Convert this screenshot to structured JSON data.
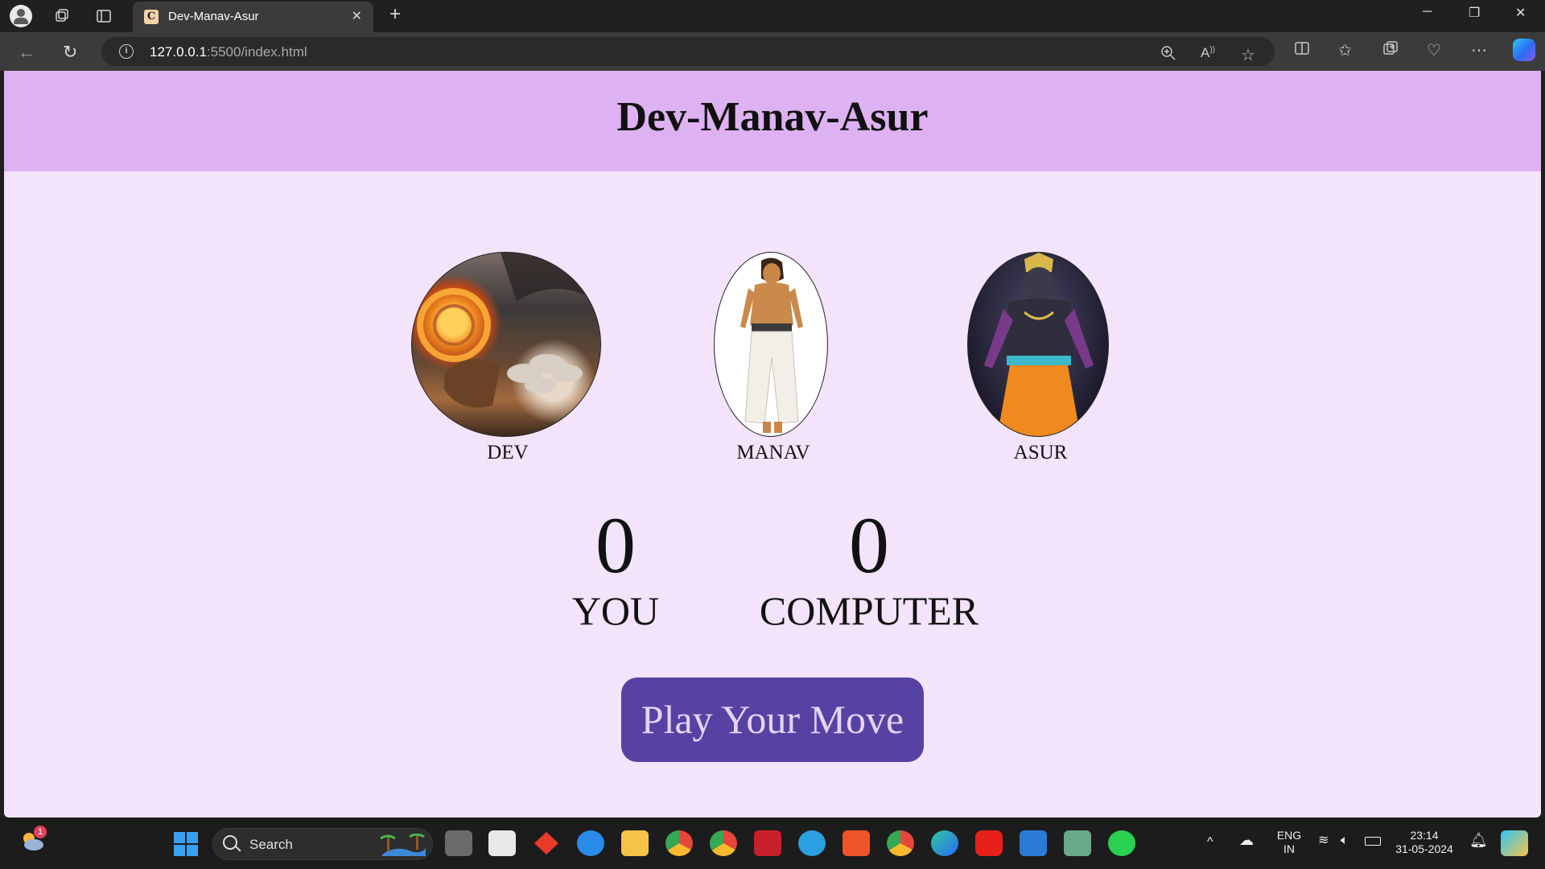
{
  "browser": {
    "tab_title": "Dev-Manav-Asur",
    "tab_favicon_letter": "C",
    "url_host": "127.0.0.1",
    "url_path": ":5500/index.html"
  },
  "page": {
    "title": "Dev-Manav-Asur",
    "choices": [
      {
        "label": "DEV",
        "image": "chariot-of-fire-image"
      },
      {
        "label": "MANAV",
        "image": "warrior-man-image"
      },
      {
        "label": "ASUR",
        "image": "demon-king-image"
      }
    ],
    "scores": {
      "you": {
        "value": "0",
        "label": "YOU"
      },
      "computer": {
        "value": "0",
        "label": "COMPUTER"
      }
    },
    "play_button": "Play Your Move"
  },
  "taskbar": {
    "search_label": "Search",
    "lang_line1": "ENG",
    "lang_line2": "IN",
    "time": "23:14",
    "date": "31-05-2024",
    "weather_badge": "1"
  },
  "colors": {
    "header_bg": "#deb1f2",
    "page_bg": "#f3e3fb",
    "button_bg": "#5542a3",
    "button_text": "#e6d3f2"
  }
}
